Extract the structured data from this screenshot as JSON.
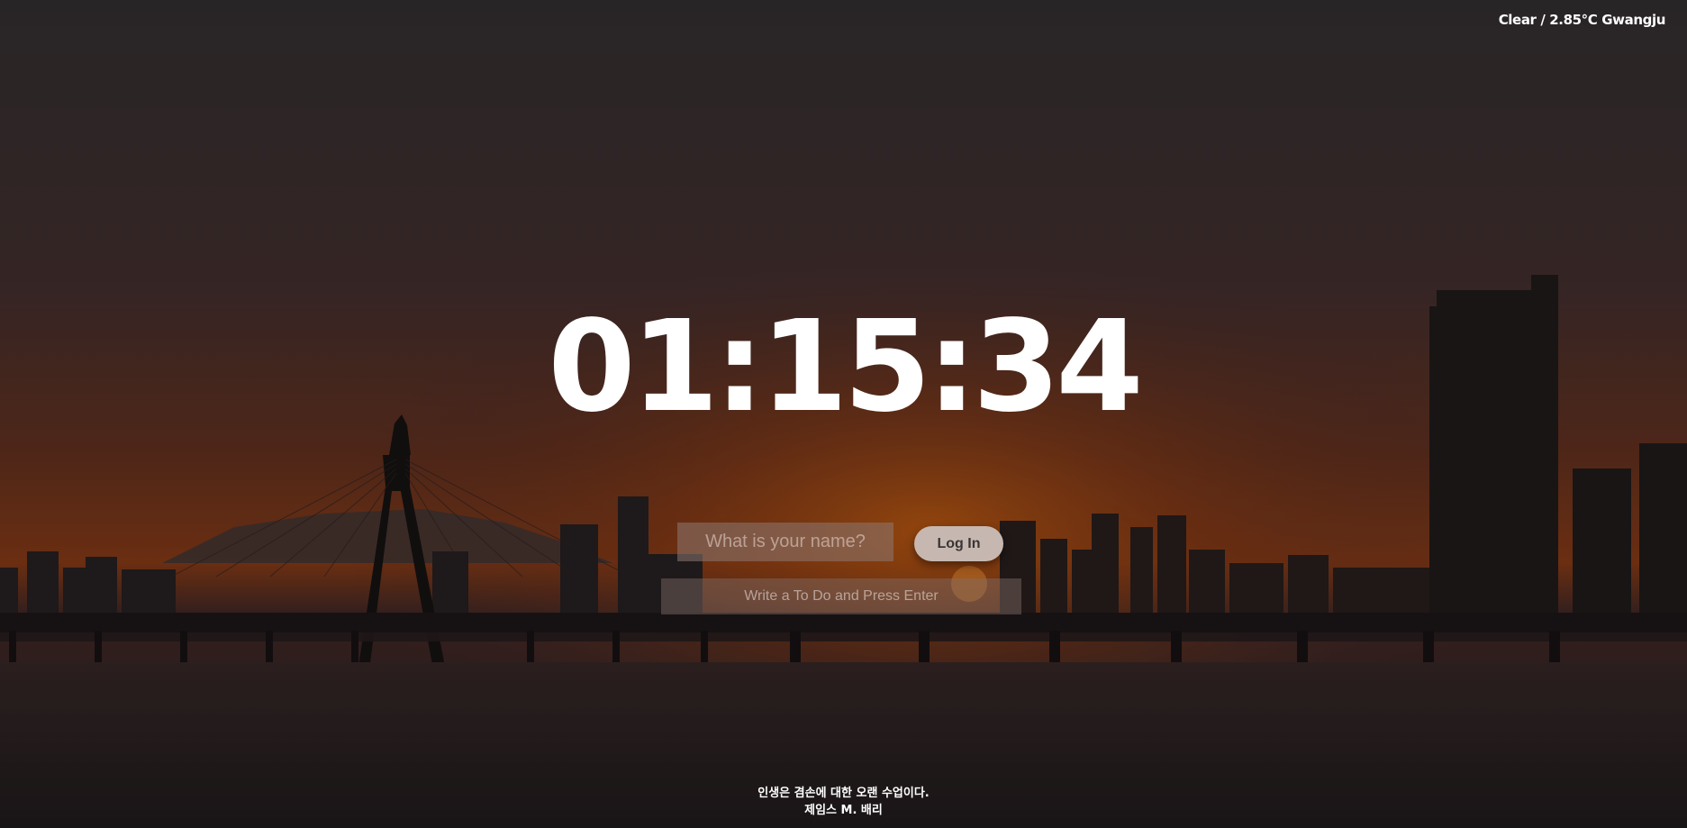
{
  "weather": {
    "text": "Clear / 2.85℃ Gwangju"
  },
  "clock": {
    "time": "01:15:34"
  },
  "login": {
    "name_placeholder": "What is your name?",
    "login_label": "Log In"
  },
  "todo": {
    "placeholder": "Write a To Do and Press Enter"
  },
  "quote": {
    "text": "인생은 겸손에 대한 오랜 수업이다.",
    "author": "제임스 M. 배리"
  },
  "colors": {
    "sky_top": "#2e2b2d",
    "sky_glow": "#8a3a12",
    "silhouette": "#1a1516",
    "water": "#2a2325",
    "text": "#ffffff",
    "button_bg": "#c6b8b0"
  }
}
